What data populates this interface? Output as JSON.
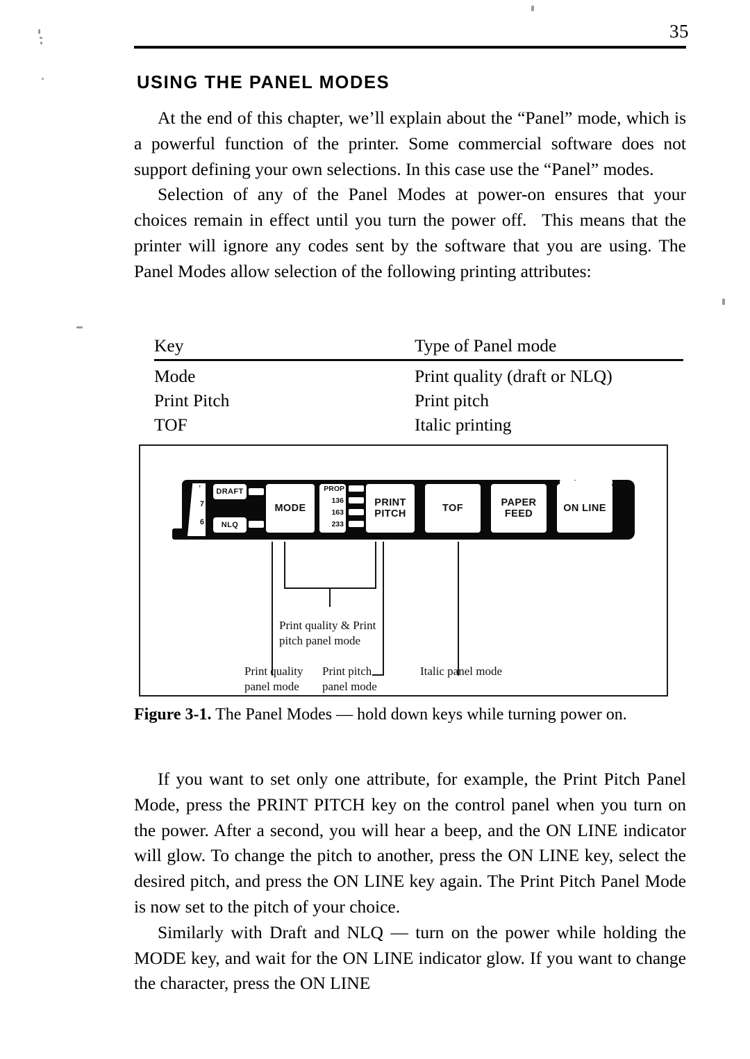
{
  "page": {
    "number": "35",
    "section_title": "USING THE PANEL MODES"
  },
  "paragraphs": {
    "p1": "At the end of this chapter, we’ll explain about the “Panel” mode, which is a powerful function of the printer. Some commercial software does not support defining your own selections. In this case use the “Panel” modes.",
    "p2": "Selection of any of the Panel Modes at power-on ensures that your choices remain in effect until you turn the power off.  This means that the printer will ignore any codes sent by the software that you are using. The Panel Modes allow selection of the following printing attributes:",
    "p3": "If you want to set only one attribute, for example, the Print Pitch Panel Mode, press the PRINT PITCH key on the control panel when you turn on the power. After a second, you will hear a beep, and the ON LINE indicator will glow. To change the pitch to another, press the ON LINE key, select the desired pitch, and press the ON LINE key again. The Print Pitch Panel Mode is now set to the pitch of your choice.",
    "p4": "Similarly with Draft and NLQ — turn on the power while holding the MODE key, and wait for the ON LINE indicator glow. If you want to change the character, press the ON LINE"
  },
  "key_table": {
    "headers": {
      "key": "Key",
      "type": "Type of Panel mode"
    },
    "rows": [
      {
        "key": "Mode",
        "type": "Print quality (draft or NLQ)"
      },
      {
        "key": "Print Pitch",
        "type": "Print pitch"
      },
      {
        "key": "TOF",
        "type": "Italic printing"
      }
    ]
  },
  "figure": {
    "caption_label": "Figure 3-1.",
    "caption_text": "The Panel Modes — hold down keys while turning power on.",
    "panel": {
      "scale_marks": [
        "’",
        "7",
        "6"
      ],
      "mode_indicators": [
        "DRAFT",
        "NLQ"
      ],
      "pitch_indicators": [
        "PROP",
        "136",
        "163",
        "233"
      ],
      "keys": [
        {
          "label": "MODE"
        },
        {
          "label_line1": "PRINT",
          "label_line2": "PITCH"
        },
        {
          "label": "TOF"
        },
        {
          "label_line1": "PAPER",
          "label_line2": "FEED"
        },
        {
          "label": "ON LINE"
        }
      ]
    },
    "callouts": {
      "combo_line1": "Print quality & Print",
      "combo_line2": "pitch panel mode",
      "quality_line1": "Print quality",
      "quality_line2": "panel mode",
      "pitch_line1": "Print pitch",
      "pitch_line2": "panel mode",
      "italic": "Italic panel mode"
    }
  }
}
